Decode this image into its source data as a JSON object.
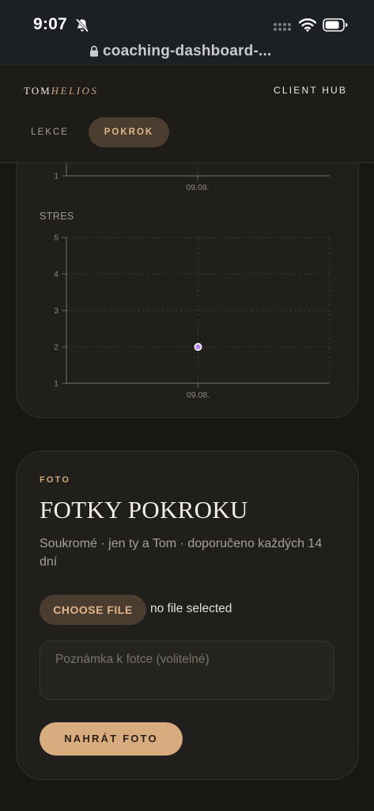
{
  "status_bar": {
    "time": "9:07"
  },
  "browser": {
    "url": "coaching-dashboard-..."
  },
  "header": {
    "brand_first": "TOM",
    "brand_second": "HELIOS",
    "client_hub": "CLIENT HUB",
    "tabs": [
      {
        "label": "LEKCE",
        "active": false
      },
      {
        "label": "POKROK",
        "active": true
      }
    ]
  },
  "charts": {
    "previous_chart": {
      "last_tick": "1",
      "x_label": "09.08."
    },
    "stres": {
      "label": "STRES",
      "y_ticks": [
        "1",
        "2",
        "3",
        "4",
        "5"
      ],
      "x_label": "09.08."
    }
  },
  "chart_data": {
    "type": "scatter",
    "title": "STRES",
    "categories": [
      "09.08."
    ],
    "values": [
      2
    ],
    "ylim": [
      1,
      5
    ],
    "grid": true,
    "point_color": "#b784f0"
  },
  "photo_section": {
    "eyebrow": "FOTO",
    "title": "FOTKY POKROKU",
    "subtitle": "Soukromé · jen ty a Tom · doporučeno každých 14 dní",
    "choose_label": "CHOOSE FILE",
    "file_status": "no file selected",
    "note_placeholder": "Poznámka k fotce (volitelné)",
    "upload_label": "NAHRÁT FOTO"
  },
  "colors": {
    "accent": "#d9ac80",
    "accent_text": "#e2b68d",
    "background": "#191714",
    "point": "#b784f0"
  }
}
